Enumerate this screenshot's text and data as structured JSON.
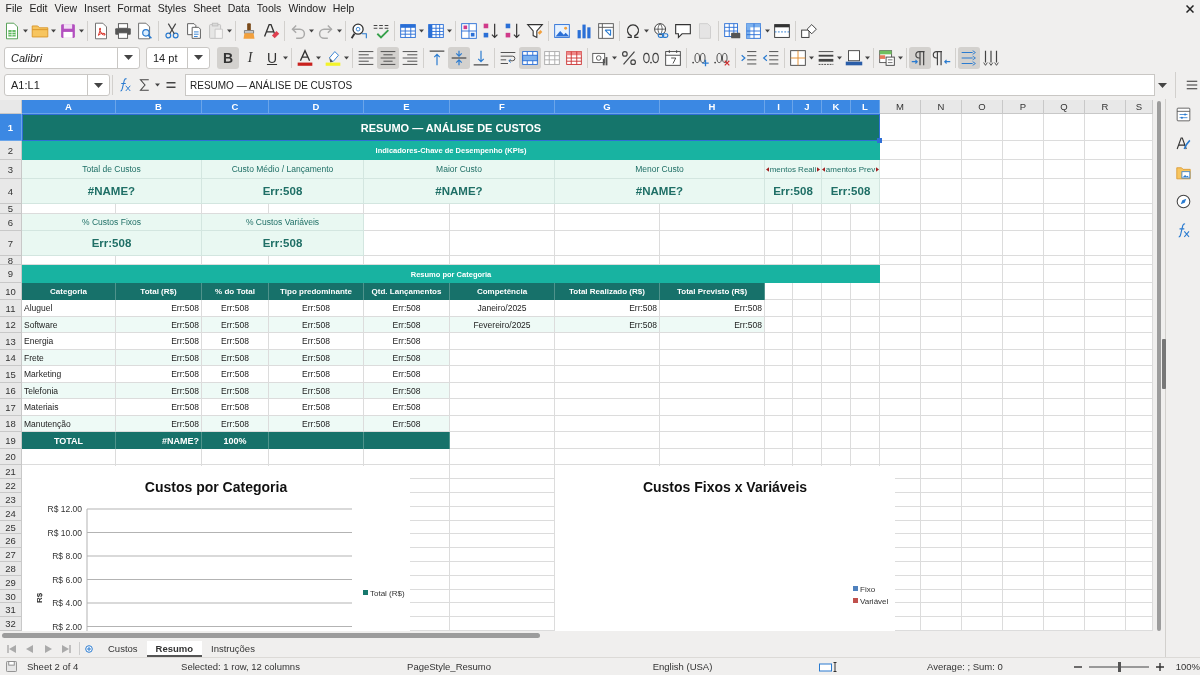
{
  "menu": [
    "File",
    "Edit",
    "View",
    "Insert",
    "Format",
    "Styles",
    "Sheet",
    "Data",
    "Tools",
    "Window",
    "Help"
  ],
  "standard_toolbar": {
    "disabled": {
      "paste": true,
      "undo": true,
      "redo": true,
      "headers_footers": true
    }
  },
  "formatting_toolbar": {
    "font_name": "Calibri",
    "font_size": "14 pt",
    "text_style_buttons": [
      {
        "kind": "bold",
        "label": "B",
        "on": true
      },
      {
        "kind": "italic",
        "label": "I",
        "on": false
      },
      {
        "kind": "underline",
        "label": "U",
        "on": false
      }
    ],
    "toggles": {
      "align_left": false,
      "align_center": true,
      "align_right": false,
      "align_top": false,
      "align_middle": true,
      "align_bottom": false,
      "wrap_text": false,
      "merge_and_center": true,
      "left_to_right": true,
      "right_to_left": false,
      "text_horizontal": true,
      "text_vertical": false
    }
  },
  "formula_bar": {
    "name_box": "A1:L1",
    "content": "RESUMO — ANÁLISE DE CUSTOS"
  },
  "column_headers": [
    {
      "label": "A",
      "selected": true
    },
    {
      "label": "B",
      "selected": true
    },
    {
      "label": "C",
      "selected": true
    },
    {
      "label": "D",
      "selected": true
    },
    {
      "label": "E",
      "selected": true
    },
    {
      "label": "F",
      "selected": true
    },
    {
      "label": "G",
      "selected": true
    },
    {
      "label": "H",
      "selected": true
    },
    {
      "label": "I",
      "selected": true
    },
    {
      "label": "J",
      "selected": true
    },
    {
      "label": "K",
      "selected": true
    },
    {
      "label": "L",
      "selected": true
    },
    {
      "label": "M",
      "selected": false
    },
    {
      "label": "N",
      "selected": false
    },
    {
      "label": "O",
      "selected": false
    },
    {
      "label": "P",
      "selected": false
    },
    {
      "label": "Q",
      "selected": false
    },
    {
      "label": "R",
      "selected": false
    },
    {
      "label": "S",
      "selected": false
    }
  ],
  "row_headers": [
    {
      "label": "1",
      "selected": true
    },
    {
      "label": "2",
      "selected": false
    },
    {
      "label": "3",
      "selected": false
    },
    {
      "label": "4",
      "selected": false
    },
    {
      "label": "5",
      "selected": false
    },
    {
      "label": "6",
      "selected": false
    },
    {
      "label": "7",
      "selected": false
    },
    {
      "label": "8",
      "selected": false
    },
    {
      "label": "9",
      "selected": false
    },
    {
      "label": "10",
      "selected": false
    },
    {
      "label": "11",
      "selected": false
    },
    {
      "label": "12",
      "selected": false
    },
    {
      "label": "13",
      "selected": false
    },
    {
      "label": "14",
      "selected": false
    },
    {
      "label": "15",
      "selected": false
    },
    {
      "label": "16",
      "selected": false
    },
    {
      "label": "17",
      "selected": false
    },
    {
      "label": "18",
      "selected": false
    },
    {
      "label": "19",
      "selected": false
    },
    {
      "label": "20",
      "selected": false
    },
    {
      "label": "21",
      "selected": false
    },
    {
      "label": "22",
      "selected": false
    },
    {
      "label": "23",
      "selected": false
    },
    {
      "label": "24",
      "selected": false
    },
    {
      "label": "25",
      "selected": false
    },
    {
      "label": "26",
      "selected": false
    },
    {
      "label": "27",
      "selected": false
    },
    {
      "label": "28",
      "selected": false
    },
    {
      "label": "29",
      "selected": false
    },
    {
      "label": "30",
      "selected": false
    },
    {
      "label": "31",
      "selected": false
    },
    {
      "label": "32",
      "selected": false
    }
  ],
  "sheet": {
    "title": "RESUMO — ANÁLISE DE CUSTOS",
    "kpi_heading": "Indicadores-Chave de Desempenho (KPIs)",
    "kpis": [
      {
        "label": "Total de Custos",
        "value": "#NAME?",
        "clipped": false
      },
      {
        "label": "Custo Médio / Lançamento",
        "value": "Err:508",
        "clipped": false
      },
      {
        "label": "Maior Custo",
        "value": "#NAME?",
        "clipped": false
      },
      {
        "label": "Menor Custo",
        "value": "#NAME?",
        "clipped": false
      },
      {
        "label": "mentos Reali",
        "value": "Err:508",
        "clipped": true
      },
      {
        "label": "amentos Prev",
        "value": "Err:508",
        "clipped": true
      },
      {
        "label": "% Custos Fixos",
        "value": "Err:508",
        "clipped": false
      },
      {
        "label": "% Custos Variáveis",
        "value": "Err:508",
        "clipped": false
      }
    ],
    "category_heading": "Resumo por Categoria",
    "category_table": {
      "columns": [
        "Categoria",
        "Total (R$)",
        "% do Total",
        "Tipo predominante",
        "Qtd. Lançamentos"
      ],
      "rows": [
        [
          "Aluguel",
          "Err:508",
          "Err:508",
          "Err:508",
          "Err:508"
        ],
        [
          "Software",
          "Err:508",
          "Err:508",
          "Err:508",
          "Err:508"
        ],
        [
          "Energia",
          "Err:508",
          "Err:508",
          "Err:508",
          "Err:508"
        ],
        [
          "Frete",
          "Err:508",
          "Err:508",
          "Err:508",
          "Err:508"
        ],
        [
          "Marketing",
          "Err:508",
          "Err:508",
          "Err:508",
          "Err:508"
        ],
        [
          "Telefonia",
          "Err:508",
          "Err:508",
          "Err:508",
          "Err:508"
        ],
        [
          "Materiais",
          "Err:508",
          "Err:508",
          "Err:508",
          "Err:508"
        ],
        [
          "Manutenção",
          "Err:508",
          "Err:508",
          "Err:508",
          "Err:508"
        ]
      ],
      "total": [
        "TOTAL",
        "#NAME?",
        "100%"
      ]
    },
    "period_table": {
      "columns": [
        "Competência",
        "Total Realizado (R$)",
        "Total Previsto (R$)"
      ],
      "rows": [
        [
          "Janeiro/2025",
          "Err:508",
          "Err:508"
        ],
        [
          "Fevereiro/2025",
          "Err:508",
          "Err:508"
        ]
      ]
    }
  },
  "charts": [
    {
      "kind": "bar",
      "title": "Custos por Categoria",
      "axis_title": "R$",
      "tick_labels": [
        "R$ 12.00",
        "R$ 10.00",
        "R$ 8.00",
        "R$ 6.00",
        "R$ 4.00",
        "R$ 2.00"
      ],
      "legend": [
        {
          "label": "Total (R$)",
          "color": "#16786d"
        }
      ]
    },
    {
      "kind": "pie",
      "title": "Custos Fixos x Variáveis",
      "legend": [
        {
          "label": "Fixo",
          "color": "#4f81bd"
        },
        {
          "label": "Variável",
          "color": "#c0504d"
        }
      ]
    }
  ],
  "sheet_tabs": [
    {
      "label": "Custos",
      "selected": false
    },
    {
      "label": "Resumo",
      "selected": true
    },
    {
      "label": "Instruções",
      "selected": false
    }
  ],
  "status_bar": {
    "sheet": "Sheet 2 of 4",
    "selection": "Selected: 1 row, 12 columns",
    "page_style": "PageStyle_Resumo",
    "language": "English (USA)",
    "summary": "Average: ; Sum: 0",
    "zoom": {
      "level": 0.5,
      "reading": "100%"
    }
  }
}
